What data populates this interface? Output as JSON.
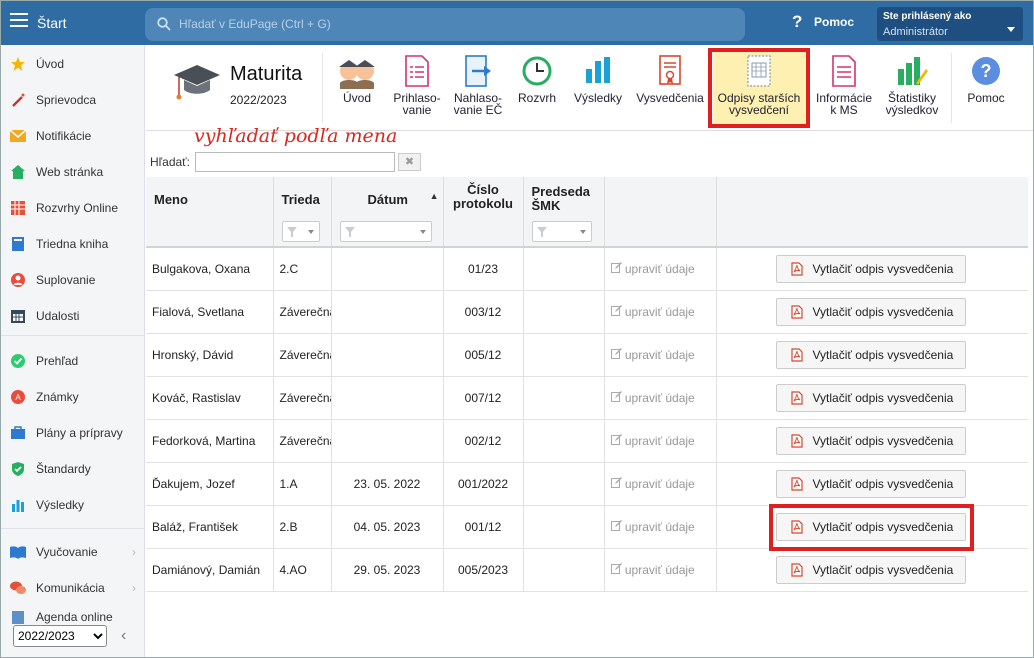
{
  "topbar": {
    "start_label": "Štart",
    "search_placeholder": "Hľadať v EduPage (Ctrl + G)",
    "help_label": "Pomoc",
    "user_line1": "Ste prihlásený ako",
    "user_line2": "Administrátor"
  },
  "sidebar": {
    "items": [
      {
        "label": "Úvod",
        "icon": "star-icon"
      },
      {
        "label": "Sprievodca",
        "icon": "magic-wand-icon"
      },
      {
        "label": "Notifikácie",
        "icon": "envelope-icon"
      },
      {
        "label": "Web stránka",
        "icon": "house-icon"
      },
      {
        "label": "Rozvrhy Online",
        "icon": "timetable-icon"
      },
      {
        "label": "Triedna kniha",
        "icon": "book-icon"
      },
      {
        "label": "Suplovanie",
        "icon": "substitute-person-icon"
      },
      {
        "label": "Udalosti",
        "icon": "calendar-icon"
      },
      {
        "label": "Prehľad",
        "icon": "check-circle-icon"
      },
      {
        "label": "Známky",
        "icon": "grades-icon"
      },
      {
        "label": "Plány a prípravy",
        "icon": "briefcase-icon"
      },
      {
        "label": "Štandardy",
        "icon": "shield-check-icon"
      },
      {
        "label": "Výsledky",
        "icon": "bar-chart-icon"
      },
      {
        "label": "Vyučovanie",
        "icon": "open-book-icon"
      },
      {
        "label": "Komunikácia",
        "icon": "chat-bubbles-icon"
      },
      {
        "label": "Agenda online",
        "icon": "agenda-icon"
      }
    ],
    "year_value": "2022/2023"
  },
  "header": {
    "title": "Maturita",
    "year": "2022/2023",
    "toolbar": [
      {
        "label": "Úvod",
        "icon": "students-icon"
      },
      {
        "label": "Prihlaso-\nvanie",
        "icon": "form-list-icon"
      },
      {
        "label": "Nahlaso-\nvanie EČ",
        "icon": "report-arrow-icon"
      },
      {
        "label": "Rozvrh",
        "icon": "clock-icon"
      },
      {
        "label": "Výsledky",
        "icon": "bar-chart-icon"
      },
      {
        "label": "Vysvedčenia",
        "icon": "certificate-icon"
      },
      {
        "label": "Odpisy starších\nvysvedčení",
        "icon": "certificate-copy-icon"
      },
      {
        "label": "Informácie\nk MS",
        "icon": "info-doc-icon"
      },
      {
        "label": "Štatistiky\nvýsledkov",
        "icon": "stats-pencil-icon"
      },
      {
        "label": "Pomoc",
        "icon": "help-circle-icon"
      }
    ]
  },
  "annotation": {
    "hint": "vyhľadať podľa mena"
  },
  "search": {
    "label": "Hľadať:",
    "value": "",
    "clear": "✖"
  },
  "table": {
    "headers": {
      "name": "Meno",
      "class": "Trieda",
      "date": "Dátum",
      "protocol": "Číslo\nprotokolu",
      "chair": "Predseda\nŠMK"
    },
    "sort_indicator": "▲",
    "edit_label": "upraviť údaje",
    "print_label": "Vytlačiť odpis vysvedčenia",
    "rows": [
      {
        "name": "Bulgakova, Oxana",
        "class": "2.C",
        "date": "",
        "protocol": "01/23",
        "chair": ""
      },
      {
        "name": "Fialová, Svetlana",
        "class": "Záverečná",
        "date": "",
        "protocol": "003/12",
        "chair": ""
      },
      {
        "name": "Hronský, Dávid",
        "class": "Záverečná",
        "date": "",
        "protocol": "005/12",
        "chair": ""
      },
      {
        "name": "Kováč, Rastislav",
        "class": "Záverečná",
        "date": "",
        "protocol": "007/12",
        "chair": ""
      },
      {
        "name": "Fedorková, Martina",
        "class": "Záverečná",
        "date": "",
        "protocol": "002/12",
        "chair": ""
      },
      {
        "name": "Ďakujem, Jozef",
        "class": "1.A",
        "date": "23. 05. 2022",
        "protocol": "001/2022",
        "chair": ""
      },
      {
        "name": "Baláž, František",
        "class": "2.B",
        "date": "04. 05. 2023",
        "protocol": "001/12",
        "chair": ""
      },
      {
        "name": "Damiánový, Damián",
        "class": "4.AO",
        "date": "29. 05. 2023",
        "protocol": "005/2023",
        "chair": ""
      }
    ]
  },
  "colors": {
    "topbar": "#2f6ca3",
    "highlight": "#e02020",
    "active_tab_bg": "#fdf0b0"
  }
}
